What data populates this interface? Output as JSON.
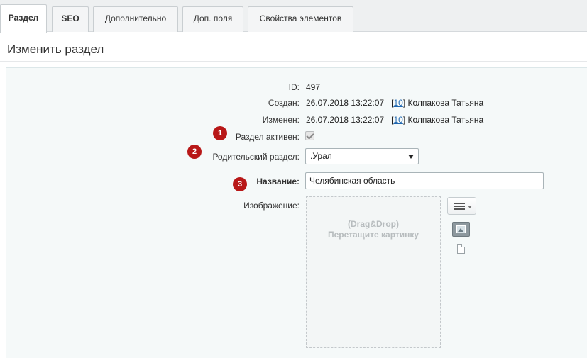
{
  "tabs": [
    {
      "label": "Раздел",
      "active": true
    },
    {
      "label": "SEO",
      "active": false
    },
    {
      "label": "Дополнительно",
      "active": false
    },
    {
      "label": "Доп. поля",
      "active": false
    },
    {
      "label": "Свойства элементов",
      "active": false
    }
  ],
  "page": {
    "title": "Изменить раздел"
  },
  "form": {
    "id_label": "ID:",
    "id_value": "497",
    "created_label": "Создан:",
    "created_date": "26.07.2018 13:22:07",
    "created_user_id": "10",
    "created_user_name": "Колпакова Татьяна",
    "modified_label": "Изменен:",
    "modified_date": "26.07.2018 13:22:07",
    "modified_user_id": "10",
    "modified_user_name": "Колпакова Татьяна",
    "active_label": "Раздел активен:",
    "active_checked": true,
    "parent_label": "Родительский раздел:",
    "parent_value": ".Урал",
    "name_label": "Название:",
    "name_value": "Челябинская область",
    "image_label": "Изображение:",
    "dropzone_line1": "(Drag&Drop)",
    "dropzone_line2": "Перетащите картинку"
  },
  "badges": [
    "1",
    "2",
    "3"
  ],
  "icons": {
    "menu": "hamburger-menu-icon",
    "image": "image-icon",
    "file": "file-icon",
    "check": "checkmark-icon",
    "select_arrow": "triangle-down-icon"
  },
  "colors": {
    "badge": "#b81818",
    "link": "#2067b0",
    "panel_bg": "#f5f9f9",
    "tabs_bg": "#eef0f1"
  }
}
